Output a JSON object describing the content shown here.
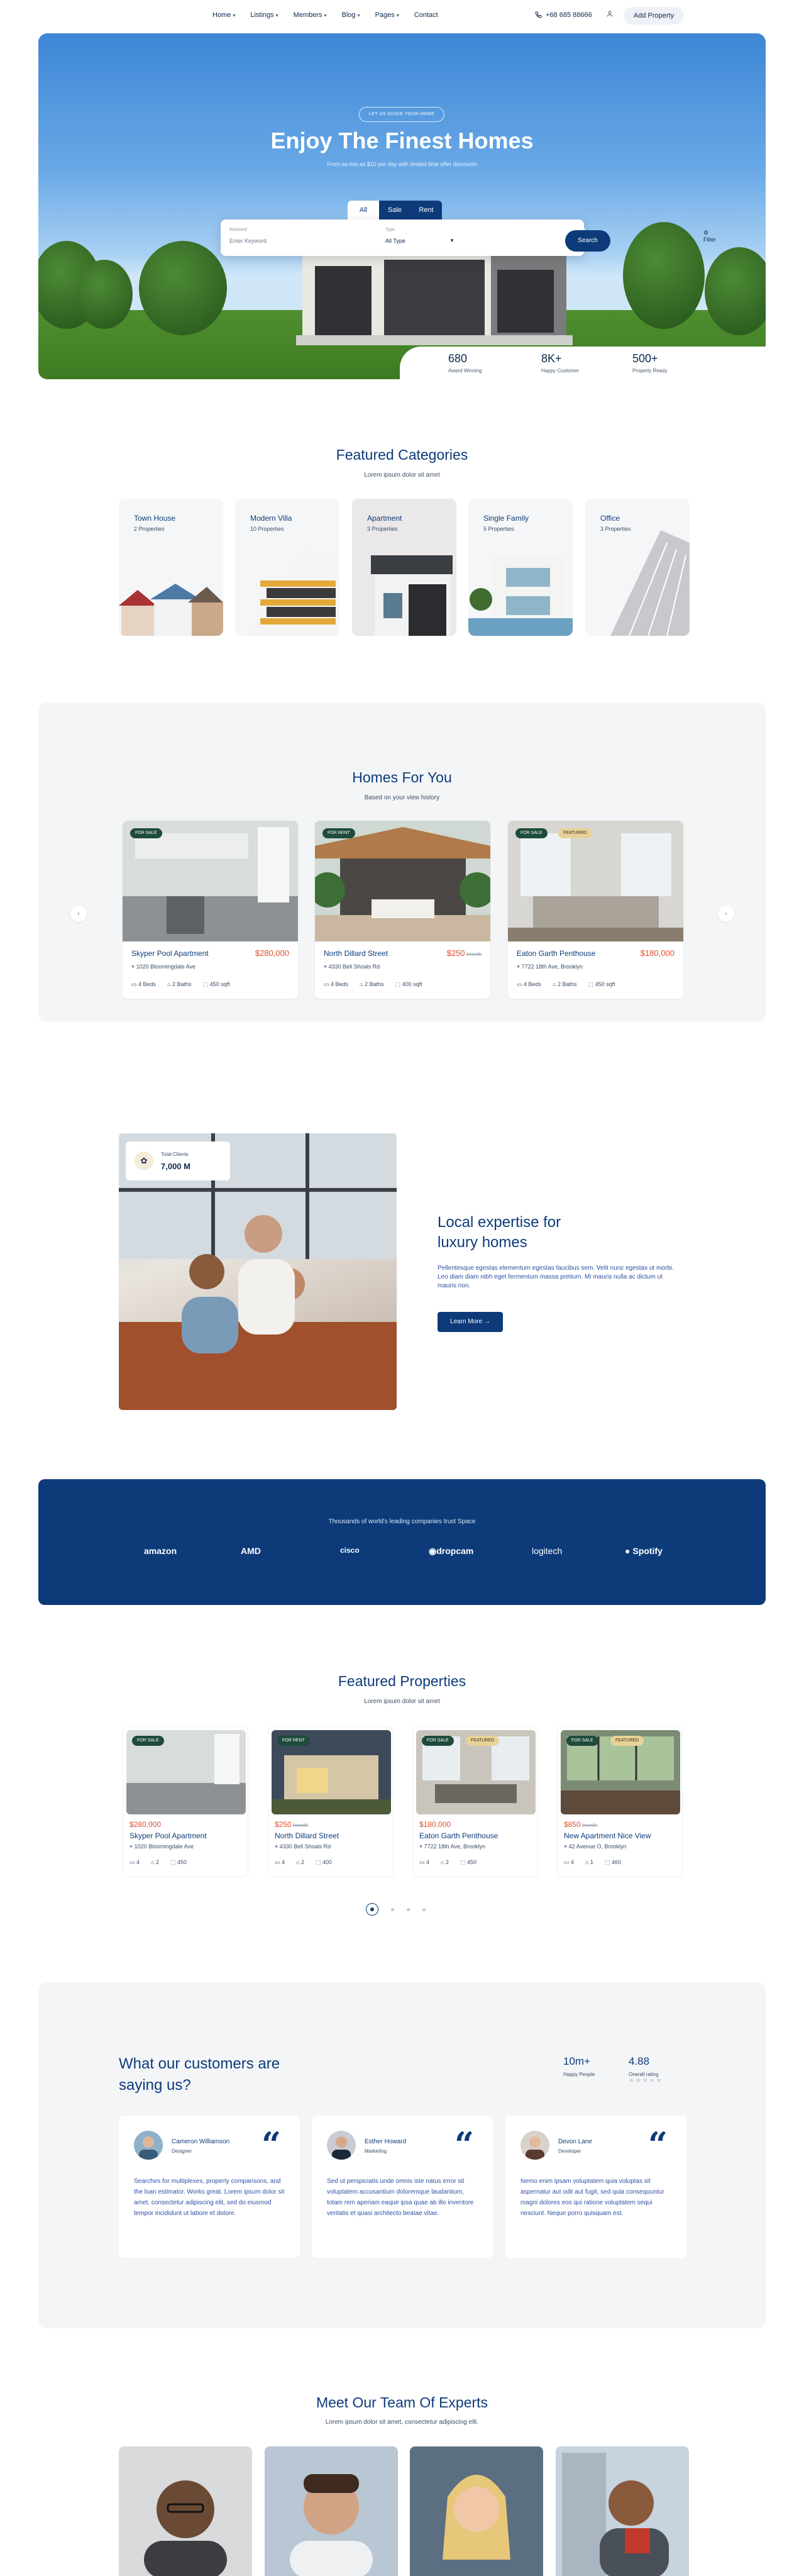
{
  "nav": {
    "items": [
      {
        "label": "Home"
      },
      {
        "label": "Listings"
      },
      {
        "label": "Members"
      },
      {
        "label": "Blog"
      },
      {
        "label": "Pages"
      },
      {
        "label": "Contact"
      }
    ],
    "caret": "▾",
    "phone": "+68 685 88666",
    "phone_icon": "phone-icon",
    "user_icon": "user-icon",
    "add_property": "Add Property"
  },
  "hero": {
    "badge": "LET US GUIDE YOUR HOME",
    "title": "Enjoy The Finest Homes",
    "subtitle": "From as low as $10 per day with limited time offer discounts",
    "tabs": [
      "All",
      "Sale",
      "Rent"
    ],
    "keyword_label": "Keyword",
    "keyword_placeholder": "Enter Keyword",
    "type_label": "Type",
    "type_value": "All Type",
    "filter_label": "Filter",
    "search_label": "Search",
    "stats": [
      {
        "n": "680",
        "l": "Award Winning"
      },
      {
        "n": "8K+",
        "l": "Happy Customer"
      },
      {
        "n": "500+",
        "l": "Property Ready"
      }
    ]
  },
  "categories": {
    "title": "Featured Categories",
    "subtitle": "Lorem ipsum dolor sit amet",
    "items": [
      {
        "t": "Town House",
        "c": "2 Properties"
      },
      {
        "t": "Modern Villa",
        "c": "10 Properties"
      },
      {
        "t": "Apartment",
        "c": "3 Properties"
      },
      {
        "t": "Single Family",
        "c": "5 Properties"
      },
      {
        "t": "Office",
        "c": "3 Properties"
      }
    ]
  },
  "homes": {
    "title": "Homes For You",
    "subtitle": "Based on your view history",
    "prev": "‹",
    "next": "›",
    "cards": [
      {
        "tags": [
          "FOR SALE"
        ],
        "name": "Skyper Pool Apartment",
        "price": "$280,000",
        "old": "",
        "addr": "1020 Bloomingdale Ave",
        "beds": "4 Beds",
        "baths": "2 Baths",
        "sqft": "450 sqft"
      },
      {
        "tags": [
          "FOR RENT"
        ],
        "name": "North Dillard Street",
        "price": "$250",
        "old": "/month",
        "addr": "4330 Bell Shoals Rd",
        "beds": "4 Beds",
        "baths": "2 Baths",
        "sqft": "400 sqft"
      },
      {
        "tags": [
          "FOR SALE",
          "FEATURED"
        ],
        "name": "Eaton Garth Penthouse",
        "price": "$180,000",
        "old": "",
        "addr": "7722 18th Ave, Brooklyn",
        "beds": "4 Beds",
        "baths": "2 Baths",
        "sqft": "450 sqft"
      }
    ]
  },
  "expertise": {
    "clients_label": "Total Clients",
    "clients_value": "7,000 M",
    "title": "Local expertise for luxury homes",
    "text": "Pellentesque egestas elementum egestas faucibus sem. Velit nunc egestas ut morbi. Leo diam diam nibh eget fermentum massa pretium. Mi mauris nulla ac dictum ut mauris non.",
    "button": "Learn More"
  },
  "trust": {
    "title": "Thousands of world's leading companies trust Space",
    "logos": [
      "amazon",
      "AMD",
      "cisco",
      "dropcam",
      "logitech",
      "Spotify"
    ]
  },
  "featured": {
    "title": "Featured Properties",
    "subtitle": "Lorem ipsum dolor sit amet",
    "cards": [
      {
        "tags": [
          "FOR SALE"
        ],
        "price": "$280,000",
        "old": "",
        "name": "Skyper Pool Apartment",
        "addr": "1020 Bloomingdale Ave",
        "beds": "4",
        "baths": "2",
        "sqft": "450"
      },
      {
        "tags": [
          "FOR RENT"
        ],
        "price": "$250",
        "old": "/month",
        "name": "North Dillard Street",
        "addr": "4330 Bell Shoals Rd",
        "beds": "4",
        "baths": "2",
        "sqft": "400"
      },
      {
        "tags": [
          "FOR SALE",
          "FEATURED"
        ],
        "price": "$180,000",
        "old": "",
        "name": "Eaton Garth Penthouse",
        "addr": "7722 18th Ave, Brooklyn",
        "beds": "4",
        "baths": "2",
        "sqft": "450"
      },
      {
        "tags": [
          "FOR SALE",
          "FEATURED"
        ],
        "price": "$850",
        "old": "/month",
        "name": "New Apartment Nice View",
        "addr": "42 Avenue O, Brooklyn",
        "beds": "4",
        "baths": "1",
        "sqft": "460"
      }
    ],
    "pages": 4,
    "active_page": 1
  },
  "testimonials": {
    "title": "What our customers are saying us?",
    "stats": [
      {
        "n": "10m+",
        "l": "Happy People"
      },
      {
        "n": "4.88",
        "l": "Overall rating",
        "stars": "★★★★★"
      }
    ],
    "items": [
      {
        "name": "Cameron Williamson",
        "role": "Designer",
        "text": "Searches for multiplexes, property comparisons, and the loan estimator. Works great. Lorem ipsum dolor sit amet, consectetur adipiscing elit, sed do eiusmod tempor incididunt ut labore et dolore."
      },
      {
        "name": "Esther Howard",
        "role": "Marketing",
        "text": "Sed ut perspiciatis unde omnis iste natus error sit voluptatem accusantium doloremque laudantium, totam rem aperiam eaque ipsa quae ab illo inventore veritatis et quasi architecto beatae vitae."
      },
      {
        "name": "Devon Lane",
        "role": "Developer",
        "text": "Nemo enim ipsam voluptatem quia voluptas sit aspernatur aut odit aut fugit, sed quia consequuntur magni dolores eos qui ratione voluptatem sequi nesciunt. Neque porro quisquam est."
      }
    ],
    "quote": "“"
  },
  "team": {
    "title": "Meet Our Team Of Experts",
    "subtitle": "Lorem ipsum dolor sit amet, consectetur adipiscing elit."
  }
}
